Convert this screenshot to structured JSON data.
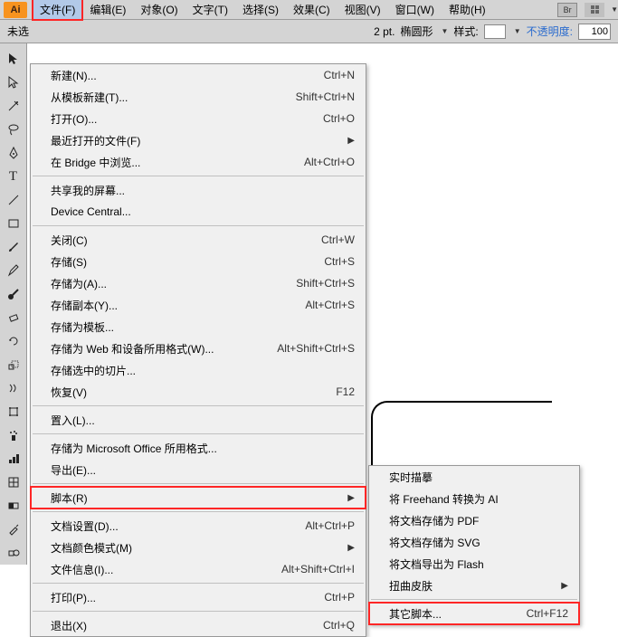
{
  "menubar": {
    "logo": "Ai",
    "items": [
      "文件(F)",
      "编辑(E)",
      "对象(O)",
      "文字(T)",
      "选择(S)",
      "效果(C)",
      "视图(V)",
      "窗口(W)",
      "帮助(H)"
    ],
    "br_icon": "Br"
  },
  "toolbar": {
    "prefix": "未选",
    "stroke_value": "2 pt.",
    "stroke_style": "椭圆形",
    "style_label": "样式:",
    "opacity_label": "不透明度:",
    "opacity_value": "100"
  },
  "file_menu": [
    {
      "label": "新建(N)...",
      "shortcut": "Ctrl+N"
    },
    {
      "label": "从模板新建(T)...",
      "shortcut": "Shift+Ctrl+N"
    },
    {
      "label": "打开(O)...",
      "shortcut": "Ctrl+O"
    },
    {
      "label": "最近打开的文件(F)",
      "shortcut": "",
      "arrow": true
    },
    {
      "label": "在 Bridge 中浏览...",
      "shortcut": "Alt+Ctrl+O"
    },
    {
      "sep": true
    },
    {
      "label": "共享我的屏幕...",
      "shortcut": ""
    },
    {
      "label": "Device Central...",
      "shortcut": ""
    },
    {
      "sep": true
    },
    {
      "label": "关闭(C)",
      "shortcut": "Ctrl+W"
    },
    {
      "label": "存储(S)",
      "shortcut": "Ctrl+S"
    },
    {
      "label": "存储为(A)...",
      "shortcut": "Shift+Ctrl+S"
    },
    {
      "label": "存储副本(Y)...",
      "shortcut": "Alt+Ctrl+S"
    },
    {
      "label": "存储为模板...",
      "shortcut": ""
    },
    {
      "label": "存储为 Web 和设备所用格式(W)...",
      "shortcut": "Alt+Shift+Ctrl+S"
    },
    {
      "label": "存储选中的切片...",
      "shortcut": ""
    },
    {
      "label": "恢复(V)",
      "shortcut": "F12"
    },
    {
      "sep": true
    },
    {
      "label": "置入(L)...",
      "shortcut": ""
    },
    {
      "sep": true
    },
    {
      "label": "存储为 Microsoft Office 所用格式...",
      "shortcut": ""
    },
    {
      "label": "导出(E)...",
      "shortcut": ""
    },
    {
      "sep": true
    },
    {
      "label": "脚本(R)",
      "shortcut": "",
      "arrow": true,
      "highlight": true
    },
    {
      "sep": true
    },
    {
      "label": "文档设置(D)...",
      "shortcut": "Alt+Ctrl+P"
    },
    {
      "label": "文档颜色模式(M)",
      "shortcut": "",
      "arrow": true
    },
    {
      "label": "文件信息(I)...",
      "shortcut": "Alt+Shift+Ctrl+I"
    },
    {
      "sep": true
    },
    {
      "label": "打印(P)...",
      "shortcut": "Ctrl+P"
    },
    {
      "sep": true
    },
    {
      "label": "退出(X)",
      "shortcut": "Ctrl+Q"
    }
  ],
  "scripts_submenu": [
    {
      "label": "实时描摹",
      "shortcut": ""
    },
    {
      "label": "将 Freehand 转换为 AI",
      "shortcut": ""
    },
    {
      "label": "将文档存储为 PDF",
      "shortcut": ""
    },
    {
      "label": "将文档存储为 SVG",
      "shortcut": ""
    },
    {
      "label": "将文档导出为 Flash",
      "shortcut": ""
    },
    {
      "label": "扭曲皮肤",
      "shortcut": "",
      "arrow": true
    },
    {
      "sep": true
    },
    {
      "label": "其它脚本...",
      "shortcut": "Ctrl+F12",
      "highlight": true
    }
  ]
}
